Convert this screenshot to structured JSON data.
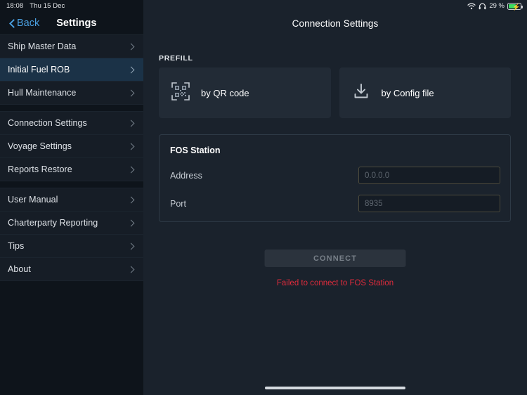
{
  "status_bar": {
    "time": "18:08",
    "date": "Thu 15 Dec",
    "wifi_icon": "wifi-icon",
    "headphones_icon": "headphones-icon",
    "battery_percent": "29 %",
    "battery_icon": "battery-charging-icon",
    "battery_level": 29,
    "battery_fill_color": "#3ddc62"
  },
  "sidebar": {
    "back_label": "Back",
    "title": "Settings",
    "accent_color": "#4a9fe0",
    "active_bg": "#1b3247",
    "groups": [
      {
        "items": [
          {
            "label": "Ship Master Data",
            "active": false
          },
          {
            "label": "Initial Fuel ROB",
            "active": true
          },
          {
            "label": "Hull Maintenance",
            "active": false
          }
        ]
      },
      {
        "items": [
          {
            "label": "Connection Settings",
            "active": false
          },
          {
            "label": "Voyage Settings",
            "active": false
          },
          {
            "label": "Reports Restore",
            "active": false
          }
        ]
      },
      {
        "items": [
          {
            "label": "User Manual",
            "active": false
          },
          {
            "label": "Charterparty Reporting",
            "active": false
          },
          {
            "label": "Tips",
            "active": false
          },
          {
            "label": "About",
            "active": false
          }
        ]
      }
    ]
  },
  "main": {
    "page_title": "Connection Settings",
    "prefill": {
      "section_label": "PREFILL",
      "options": [
        {
          "label": "by QR code",
          "icon": "qr-code-icon"
        },
        {
          "label": "by Config file",
          "icon": "download-icon"
        }
      ]
    },
    "fos_station": {
      "title": "FOS Station",
      "fields": [
        {
          "label": "Address",
          "value": "",
          "placeholder": "0.0.0.0"
        },
        {
          "label": "Port",
          "value": "",
          "placeholder": "8935"
        }
      ]
    },
    "connect_button": {
      "label": "CONNECT",
      "disabled": true
    },
    "error_message": "Failed to connect to FOS Station",
    "error_color": "#e02b3c"
  }
}
